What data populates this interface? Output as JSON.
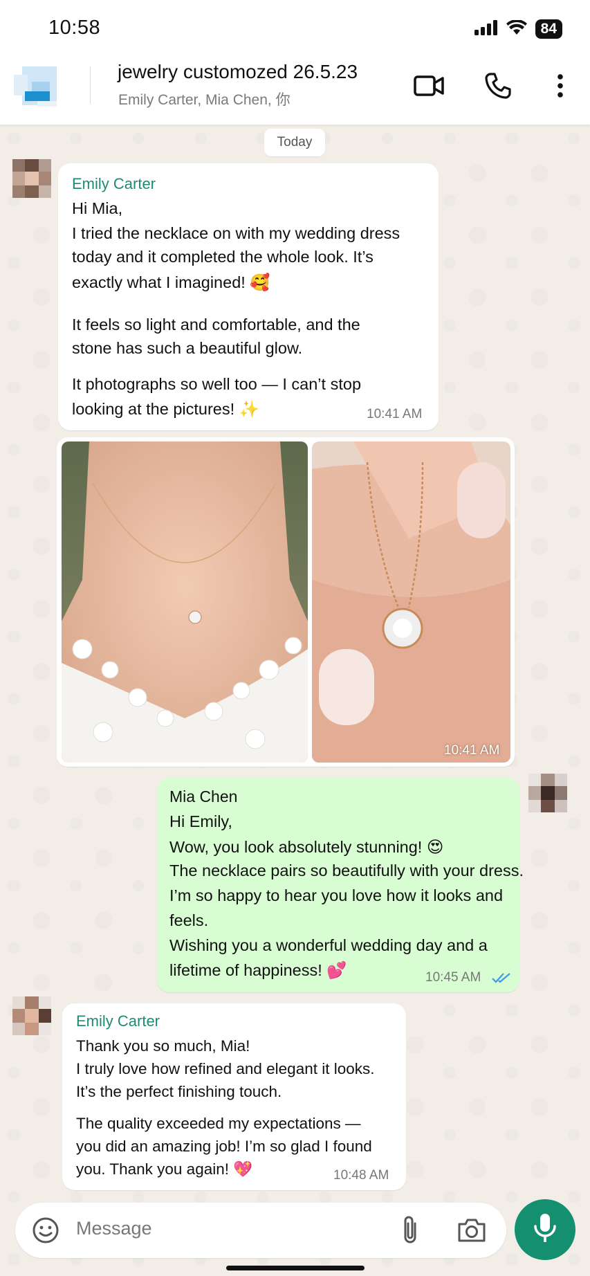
{
  "status_bar": {
    "time": "10:58",
    "battery": "84"
  },
  "header": {
    "title": "jewelry customozed 26.5.23",
    "subtitle": "Emily Carter,  Mia Chen,  你"
  },
  "date_chip": "Today",
  "messages": [
    {
      "sender": "Emily Carter",
      "lines": [
        "Hi Mia,",
        "I tried the necklace on with my wedding dress",
        "today and it completed the whole look. It’s",
        "exactly what I imagined! 🥰",
        "It feels so light and comfortable, and the",
        "stone has such a beautiful glow.",
        "It photographs so well too — I can’t stop",
        "looking at the pictures! ✨"
      ],
      "time": "10:41 AM"
    },
    {
      "type": "images",
      "time": "10:41 AM"
    },
    {
      "sender": "Mia Chen",
      "lines": [
        "Hi Emily,",
        "Wow, you look absolutely stunning! 😍",
        "The necklace pairs so beautifully with your dress.",
        "I’m so happy to hear you love how it looks and",
        "feels.",
        "Wishing you a wonderful wedding day and a",
        "lifetime of happiness! 💕"
      ],
      "time": "10:45 AM"
    },
    {
      "sender": "Emily Carter",
      "lines": [
        "Thank you so much, Mia!",
        "I truly love how refined and elegant it looks.",
        "It’s the perfect finishing touch.",
        "The quality exceeded my expectations —",
        "you did an amazing job! I’m so glad I found",
        "you. Thank you again! 💖"
      ],
      "time": "10:48 AM"
    }
  ],
  "composer": {
    "placeholder": "Message"
  },
  "icons": [
    "signal-icon",
    "wifi-icon",
    "video-call-icon",
    "phone-icon",
    "more-icon",
    "emoji-icon",
    "attach-icon",
    "camera-icon",
    "mic-icon",
    "read-receipt-icon"
  ],
  "colors": {
    "accent": "#148f6f",
    "sender_name": "#1f8a73",
    "outgoing_bubble": "#d9fdd3",
    "read_tick": "#3b9be8"
  }
}
